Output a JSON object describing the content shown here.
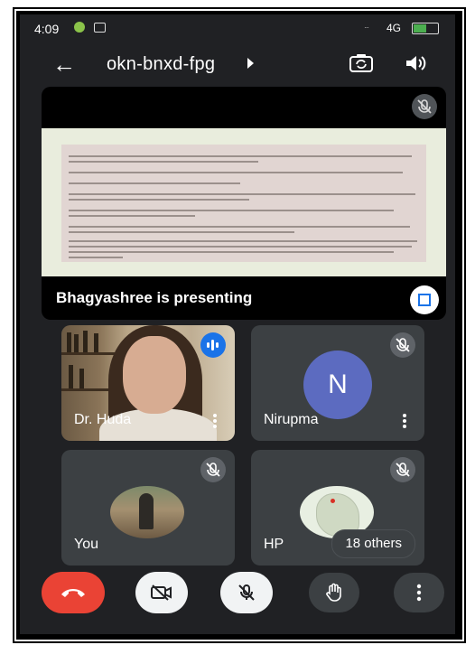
{
  "status_bar": {
    "time": "4:09",
    "network": "4G",
    "signal": "···"
  },
  "meeting": {
    "code": "okn-bnxd-fpg"
  },
  "presentation": {
    "label": "Bhagyashree is presenting"
  },
  "participants": [
    {
      "name": "Dr. Huda",
      "speaking": true
    },
    {
      "name": "Nirupma",
      "initial": "N",
      "muted": true
    },
    {
      "name": "You",
      "muted": true
    },
    {
      "name": "HP",
      "muted": true,
      "others_label": "18 others"
    }
  ],
  "colors": {
    "background": "#202124",
    "tile": "#3c4043",
    "end_call": "#ea4335",
    "avatar_n": "#5c6bc0",
    "speaking": "#1a73e8"
  },
  "icons": {
    "back": "arrow-left",
    "switch_camera": "switch-camera-icon",
    "speaker": "speaker-icon",
    "end_call": "phone-hangup-icon",
    "video_off": "video-off-icon",
    "mic_off": "mic-off-icon",
    "raise_hand": "hand-icon",
    "more": "more-vert-icon"
  }
}
